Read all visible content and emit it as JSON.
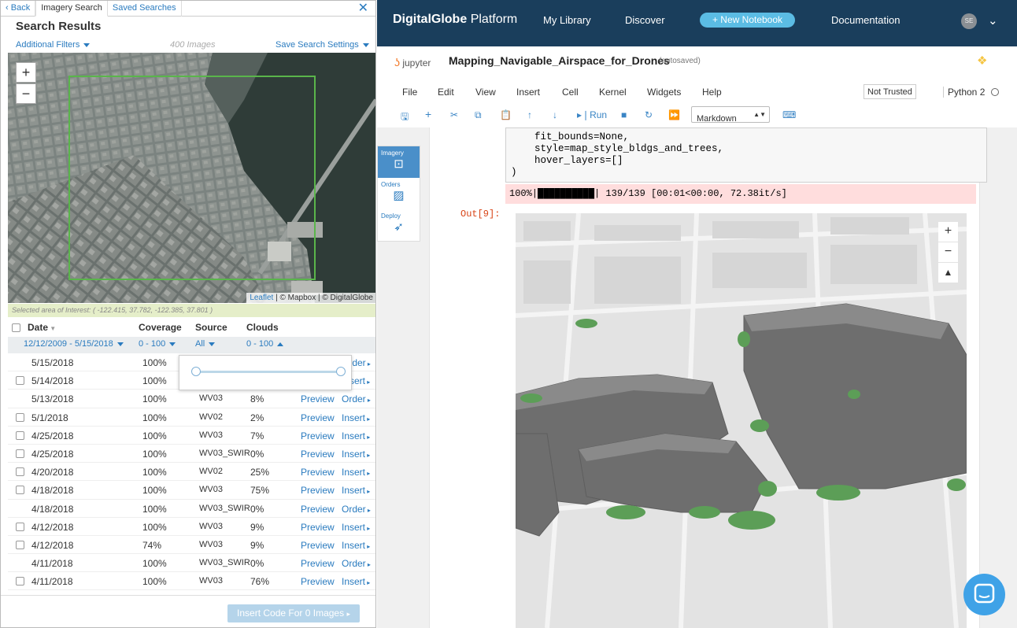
{
  "left": {
    "tabs": {
      "back": "Back",
      "imagery": "Imagery Search",
      "saved": "Saved Searches"
    },
    "title": "Search Results",
    "filters": {
      "additional": "Additional Filters",
      "count": "400 Images",
      "save": "Save Search Settings"
    },
    "map": {
      "zoom_in": "+",
      "zoom_out": "−",
      "attr_leaflet": "Leaflet",
      "attr_rest": "| © Mapbox | © DigitalGlobe"
    },
    "aoi": "Selected area of Interest: ( -122.415, 37.782, -122.385, 37.801 )",
    "columns": {
      "date": "Date",
      "coverage": "Coverage",
      "source": "Source",
      "clouds": "Clouds"
    },
    "filter_row": {
      "date": "12/12/2009 - 5/15/2018",
      "coverage": "0 - 100",
      "source": "All",
      "clouds": "0 - 100"
    },
    "rows": [
      {
        "date": "5/15/2018",
        "cov": "100%",
        "src": "",
        "cloud": "",
        "preview": "",
        "action": "Order",
        "cb": false
      },
      {
        "date": "5/14/2018",
        "cov": "100%",
        "src": "",
        "cloud": "",
        "preview": "",
        "action": "Insert",
        "cb": true
      },
      {
        "date": "5/13/2018",
        "cov": "100%",
        "src": "WV03",
        "cloud": "8%",
        "preview": "Preview",
        "action": "Order",
        "cb": false
      },
      {
        "date": "5/1/2018",
        "cov": "100%",
        "src": "WV02",
        "cloud": "2%",
        "preview": "Preview",
        "action": "Insert",
        "cb": true
      },
      {
        "date": "4/25/2018",
        "cov": "100%",
        "src": "WV03",
        "cloud": "7%",
        "preview": "Preview",
        "action": "Insert",
        "cb": true
      },
      {
        "date": "4/25/2018",
        "cov": "100%",
        "src": "WV03_SWIR",
        "cloud": "0%",
        "preview": "Preview",
        "action": "Insert",
        "cb": true
      },
      {
        "date": "4/20/2018",
        "cov": "100%",
        "src": "WV02",
        "cloud": "25%",
        "preview": "Preview",
        "action": "Insert",
        "cb": true
      },
      {
        "date": "4/18/2018",
        "cov": "100%",
        "src": "WV03",
        "cloud": "75%",
        "preview": "Preview",
        "action": "Insert",
        "cb": true
      },
      {
        "date": "4/18/2018",
        "cov": "100%",
        "src": "WV03_SWIR",
        "cloud": "0%",
        "preview": "Preview",
        "action": "Order",
        "cb": false
      },
      {
        "date": "4/12/2018",
        "cov": "100%",
        "src": "WV03",
        "cloud": "9%",
        "preview": "Preview",
        "action": "Insert",
        "cb": true
      },
      {
        "date": "4/12/2018",
        "cov": "74%",
        "src": "WV03",
        "cloud": "9%",
        "preview": "Preview",
        "action": "Insert",
        "cb": true
      },
      {
        "date": "4/11/2018",
        "cov": "100%",
        "src": "WV03_SWIR",
        "cloud": "0%",
        "preview": "Preview",
        "action": "Order",
        "cb": false
      },
      {
        "date": "4/11/2018",
        "cov": "100%",
        "src": "WV03",
        "cloud": "76%",
        "preview": "Preview",
        "action": "Insert",
        "cb": true
      }
    ],
    "insert_button": "Insert Code For 0 Images"
  },
  "sidebar": {
    "imagery": "Imagery",
    "orders": "Orders",
    "deploy": "Deploy"
  },
  "topbar": {
    "logo_a": "DigitalGlobe",
    "logo_b": "Platform",
    "nav": [
      "My Library",
      "Discover",
      "Documentation"
    ],
    "new_notebook": "+ New Notebook",
    "avatar": "SE"
  },
  "notebook": {
    "jupyter": "jupyter",
    "title": "Mapping_Navigable_Airspace_for_Drones",
    "autosaved": "(autosaved)",
    "menu": [
      "File",
      "Edit",
      "View",
      "Insert",
      "Cell",
      "Kernel",
      "Widgets",
      "Help"
    ],
    "trusted": "Not Trusted",
    "kernel": "Python 2",
    "run": "Run",
    "cell_type": "Markdown",
    "code_lines": [
      "    fit_bounds=None,",
      "    style=map_style_bldgs_and_trees,",
      "    hover_layers=[]",
      ")"
    ],
    "progress": "100%|██████████| 139/139 [00:01<00:00, 72.38it/s]",
    "out_label": "Out[9]:"
  },
  "colors": {
    "accent": "#2a7bbf",
    "topbar": "#1a3e5c",
    "new_nb": "#5bbce4",
    "aoi": "#e5eec9",
    "building": "#6e6e6e",
    "tree": "#5c9e57"
  }
}
